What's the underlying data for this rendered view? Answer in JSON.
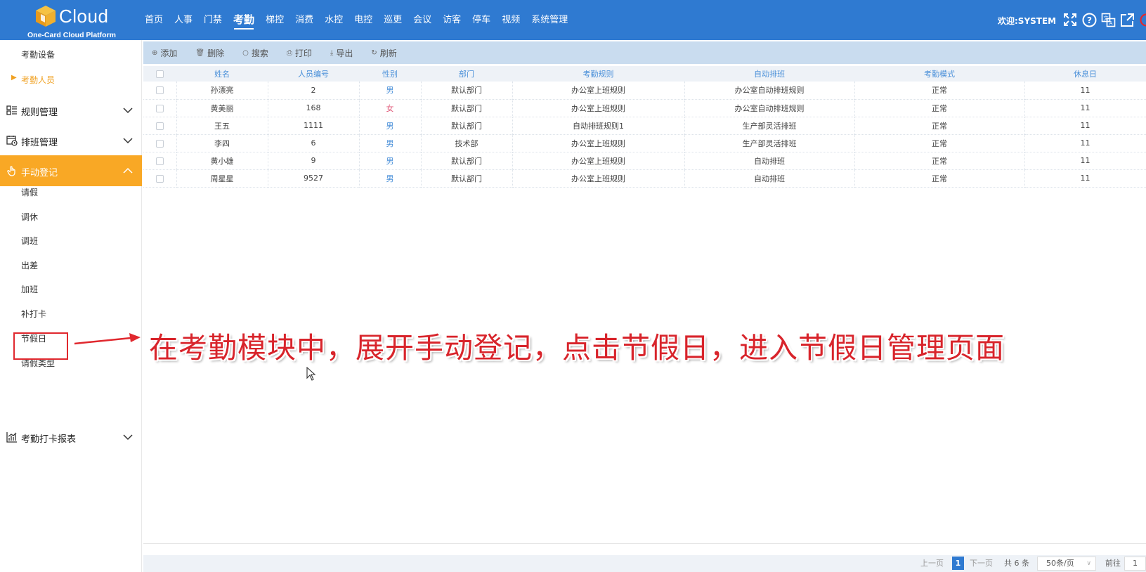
{
  "app": {
    "logo_text": "Cloud",
    "logo_sub": "One-Card Cloud Platform",
    "welcome": "欢迎:SYSTEM"
  },
  "nav": {
    "items": [
      "首页",
      "人事",
      "门禁",
      "考勤",
      "梯控",
      "消费",
      "水控",
      "电控",
      "巡更",
      "会议",
      "访客",
      "停车",
      "视频",
      "系统管理"
    ],
    "active": "考勤"
  },
  "header_icons": [
    "fullscreen-icon",
    "help-icon",
    "language-icon",
    "external-link-icon",
    "power-icon"
  ],
  "sidebar": {
    "attendance_device": "考勤设备",
    "attendance_person": "考勤人员",
    "rule_mgmt": "规则管理",
    "shift_mgmt": "排班管理",
    "manual_reg": "手动登记",
    "sub_items": [
      "请假",
      "调休",
      "调班",
      "出差",
      "加班",
      "补打卡",
      "节假日",
      "请假类型"
    ],
    "report": "考勤打卡报表"
  },
  "toolbar": {
    "add": "添加",
    "delete": "删除",
    "search": "搜索",
    "print": "打印",
    "export": "导出",
    "refresh": "刷新"
  },
  "table": {
    "headers": [
      "姓名",
      "人员编号",
      "性别",
      "部门",
      "考勤规则",
      "自动排班",
      "考勤模式",
      "休息日"
    ],
    "rows": [
      [
        "孙漂亮",
        "2",
        "男",
        "默认部门",
        "办公室上班规则",
        "办公室自动排班规则",
        "正常",
        "11"
      ],
      [
        "黄美丽",
        "168",
        "女",
        "默认部门",
        "办公室上班规则",
        "办公室自动排班规则",
        "正常",
        "11"
      ],
      [
        "王五",
        "1111",
        "男",
        "默认部门",
        "自动排班规则1",
        "生产部灵活排班",
        "正常",
        "11"
      ],
      [
        "李四",
        "6",
        "男",
        "技术部",
        "办公室上班规则",
        "生产部灵活排班",
        "正常",
        "11"
      ],
      [
        "黄小雄",
        "9",
        "男",
        "默认部门",
        "办公室上班规则",
        "自动排班",
        "正常",
        "11"
      ],
      [
        "周星星",
        "9527",
        "男",
        "默认部门",
        "办公室上班规则",
        "自动排班",
        "正常",
        "11"
      ]
    ]
  },
  "annotation": {
    "text": "在考勤模块中，展开手动登记，点击节假日，进入节假日管理页面"
  },
  "pagination": {
    "prev": "上一页",
    "current": "1",
    "next": "下一页",
    "total": "共 6 条",
    "page_size": "50条/页",
    "goto": "前往",
    "goto_value": "1"
  },
  "colors": {
    "topbar": "#2f7ad1",
    "active_menu": "#f9a825",
    "annotation_red": "#d8242b",
    "male": "#4a90d9",
    "female": "#e05a7a"
  }
}
